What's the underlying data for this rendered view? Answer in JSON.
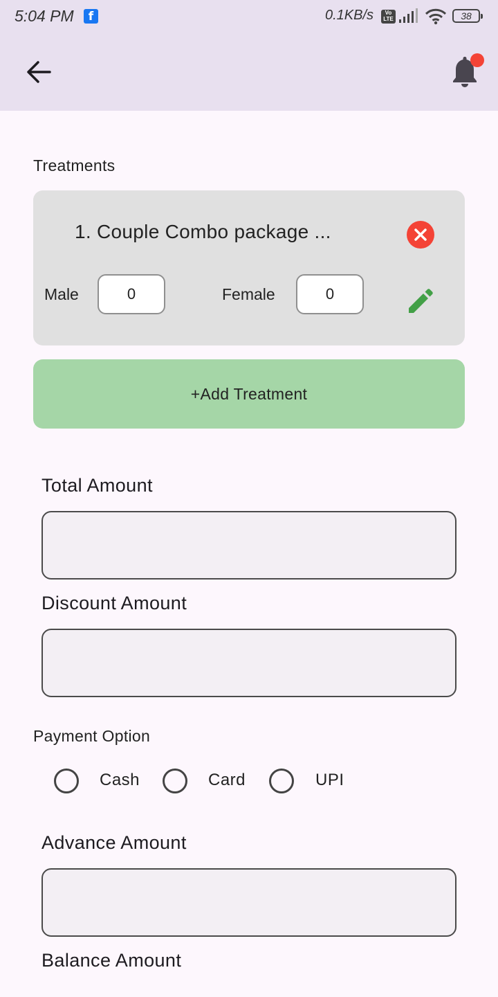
{
  "status_bar": {
    "time": "5:04 PM",
    "facebook_glyph": "f",
    "net_speed": "0.1KB/s",
    "volte_top": "Vo",
    "volte_bottom": "LTE",
    "battery": "38"
  },
  "app_bar": {
    "back_icon": "arrow-left-icon",
    "bell_icon": "bell-icon",
    "has_notification": true
  },
  "treatments": {
    "section_label": "Treatments",
    "items": [
      {
        "name": "1. Couple Combo package ...",
        "male_label": "Male",
        "male_count": "0",
        "female_label": "Female",
        "female_count": "0"
      }
    ],
    "add_button_label": "+Add Treatment"
  },
  "total_amount": {
    "label": "Total Amount",
    "value": ""
  },
  "discount_amount": {
    "label": "Discount Amount",
    "value": ""
  },
  "payment": {
    "label": "Payment Option",
    "options": [
      "Cash",
      "Card",
      "UPI"
    ]
  },
  "advance_amount": {
    "label": "Advance Amount",
    "value": ""
  },
  "balance_amount": {
    "label": "Balance Amount"
  },
  "colors": {
    "app_bar": "#e8e0ef",
    "background": "#fdf7fd",
    "card": "#e0e0e0",
    "add_button": "#a5d6a7",
    "remove": "#f44336",
    "edit": "#43a047",
    "notification_dot": "#f44336"
  }
}
